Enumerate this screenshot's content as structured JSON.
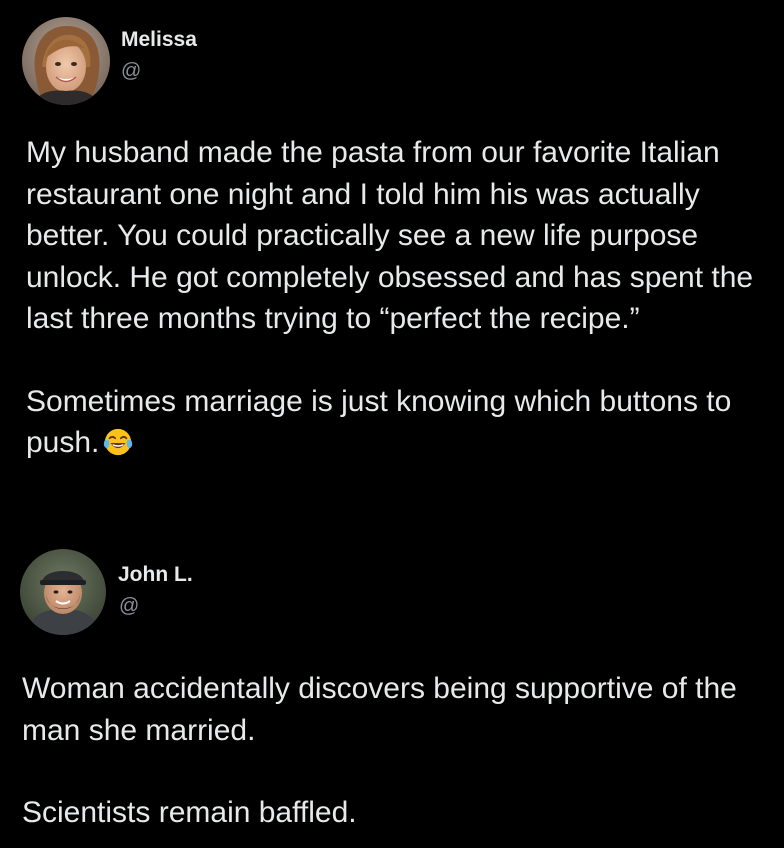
{
  "posts": [
    {
      "author": {
        "name": "Melissa",
        "handle": "@",
        "avatar": "woman-avatar-photo"
      },
      "paragraphs": [
        "My husband made the pasta from our favorite Italian restaurant one night and I told him his was actually better. You could practically see a new life purpose unlock. He got completely obsessed and has spent the last three months trying to “perfect the recipe.”",
        "Sometimes marriage is just knowing which buttons to push."
      ],
      "trailing_emoji": "face-with-tears-of-joy-icon"
    },
    {
      "author": {
        "name": "John L.",
        "handle": "@",
        "avatar": "man-with-cap-avatar-photo"
      },
      "paragraphs": [
        "Woman accidentally discovers being supportive of the man she married.",
        "Scientists remain baffled."
      ]
    }
  ],
  "colors": {
    "background": "#000000",
    "text": "#e7e9ea",
    "handle": "#8b9096"
  }
}
